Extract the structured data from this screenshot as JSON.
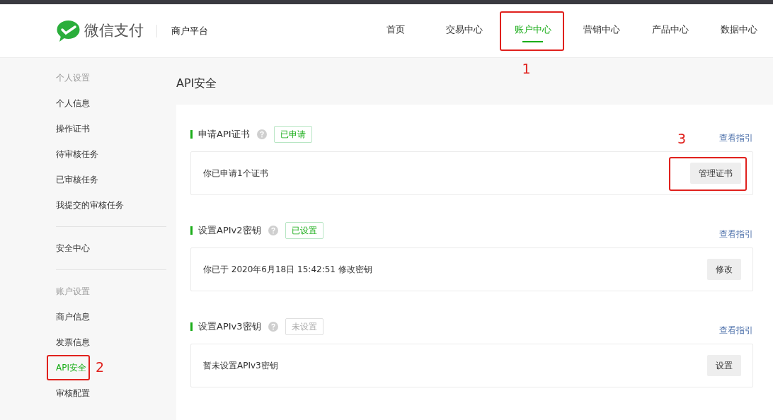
{
  "brand": {
    "name": "微信支付",
    "platform": "商户平台"
  },
  "nav": [
    {
      "label": "首页",
      "selected": false
    },
    {
      "label": "交易中心",
      "selected": false
    },
    {
      "label": "账户中心",
      "selected": true
    },
    {
      "label": "营销中心",
      "selected": false
    },
    {
      "label": "产品中心",
      "selected": false
    },
    {
      "label": "数据中心",
      "selected": false
    }
  ],
  "sidebar": [
    {
      "heading": "个人设置",
      "items": [
        {
          "label": "个人信息",
          "selected": false
        },
        {
          "label": "操作证书",
          "selected": false
        },
        {
          "label": "待审核任务",
          "selected": false
        },
        {
          "label": "已审核任务",
          "selected": false
        },
        {
          "label": "我提交的审核任务",
          "selected": false
        }
      ]
    },
    {
      "items": [
        {
          "label": "安全中心",
          "selected": false
        }
      ]
    },
    {
      "heading": "账户设置",
      "items": [
        {
          "label": "商户信息",
          "selected": false
        },
        {
          "label": "发票信息",
          "selected": false
        },
        {
          "label": "API安全",
          "selected": true
        },
        {
          "label": "审核配置",
          "selected": false
        }
      ]
    }
  ],
  "page_title": "API安全",
  "sections": [
    {
      "title": "申请API证书",
      "status": "已申请",
      "done": true,
      "guide": "查看指引",
      "description": "你已申请1个证书",
      "button": "管理证书"
    },
    {
      "title": "设置APIv2密钥",
      "status": "已设置",
      "done": true,
      "guide": "查看指引",
      "description": "你已于 2020年6月18日 15:42:51 修改密钥",
      "button": "修改"
    },
    {
      "title": "设置APIv3密钥",
      "status": "未设置",
      "done": false,
      "guide": "查看指引",
      "description": "暂未设置APIv3密钥",
      "button": "设置"
    }
  ],
  "annotations": [
    {
      "label": "1"
    },
    {
      "label": "2"
    },
    {
      "label": "3"
    }
  ]
}
